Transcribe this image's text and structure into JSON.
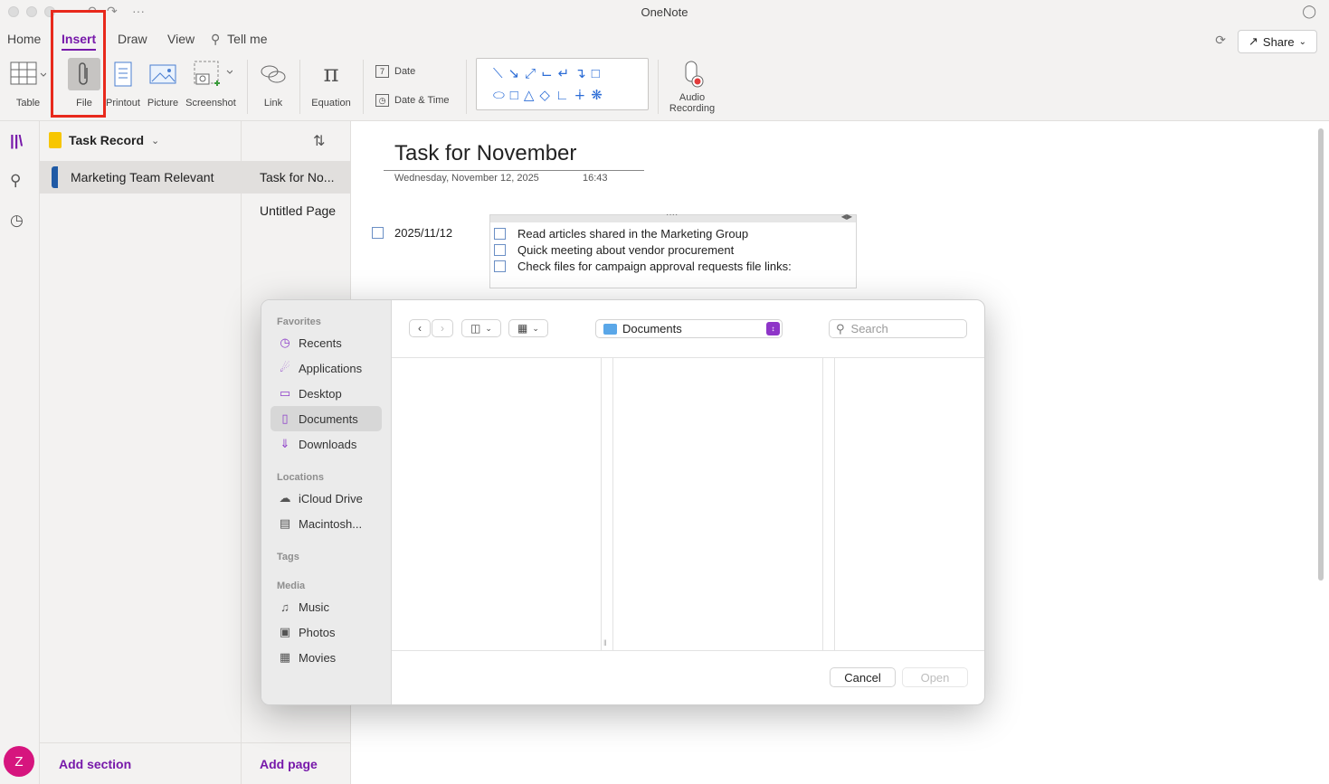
{
  "app": {
    "title": "OneNote"
  },
  "titlebar": {
    "undo_icon": "undo-icon",
    "redo_icon": "redo-icon",
    "more": "···"
  },
  "tabs": [
    {
      "label": "Home",
      "active": false
    },
    {
      "label": "Insert",
      "active": true
    },
    {
      "label": "Draw",
      "active": false
    },
    {
      "label": "View",
      "active": false
    }
  ],
  "tell_me": "Tell me",
  "share": {
    "label": "Share"
  },
  "ribbon": {
    "table": "Table",
    "file": "File",
    "printout": "Printout",
    "picture": "Picture",
    "screenshot": "Screenshot",
    "link": "Link",
    "equation": "Equation",
    "date": "Date",
    "date_time": "Date & Time",
    "audio_line1": "Audio",
    "audio_line2": "Recording"
  },
  "sections": {
    "notebook": "Task Record",
    "items": [
      {
        "label": "Marketing Team Relevant",
        "color": "#1f5aa5"
      }
    ],
    "add_label": "Add section"
  },
  "pages": {
    "items": [
      {
        "label": "Task for No..."
      },
      {
        "label": "Untitled Page"
      }
    ],
    "add_label": "Add page"
  },
  "page": {
    "title": "Task for November",
    "date": "Wednesday, November 12, 2025",
    "time": "16:43",
    "left_item": "2025/11/12",
    "todos": [
      "Read articles shared in the Marketing Group",
      "Quick meeting about vendor procurement",
      "Check files for campaign approval requests  file links:"
    ]
  },
  "avatar": {
    "initial": "Z",
    "color": "#d6157e"
  },
  "dialog": {
    "location": "Documents",
    "search_placeholder": "Search",
    "groups": {
      "favorites": "Favorites",
      "locations": "Locations",
      "tags": "Tags",
      "media": "Media"
    },
    "favorites": [
      {
        "label": "Recents",
        "icon": "clock-icon"
      },
      {
        "label": "Applications",
        "icon": "applications-icon"
      },
      {
        "label": "Desktop",
        "icon": "desktop-icon"
      },
      {
        "label": "Documents",
        "icon": "document-icon",
        "selected": true
      },
      {
        "label": "Downloads",
        "icon": "download-icon"
      }
    ],
    "locations": [
      {
        "label": "iCloud Drive",
        "icon": "cloud-icon"
      },
      {
        "label": "Macintosh...",
        "icon": "disk-icon"
      }
    ],
    "media": [
      {
        "label": "Music",
        "icon": "music-icon"
      },
      {
        "label": "Photos",
        "icon": "camera-icon"
      },
      {
        "label": "Movies",
        "icon": "film-icon"
      }
    ],
    "cancel": "Cancel",
    "open": "Open"
  },
  "colors": {
    "accent": "#7719aa",
    "highlight": "#e8291c"
  }
}
